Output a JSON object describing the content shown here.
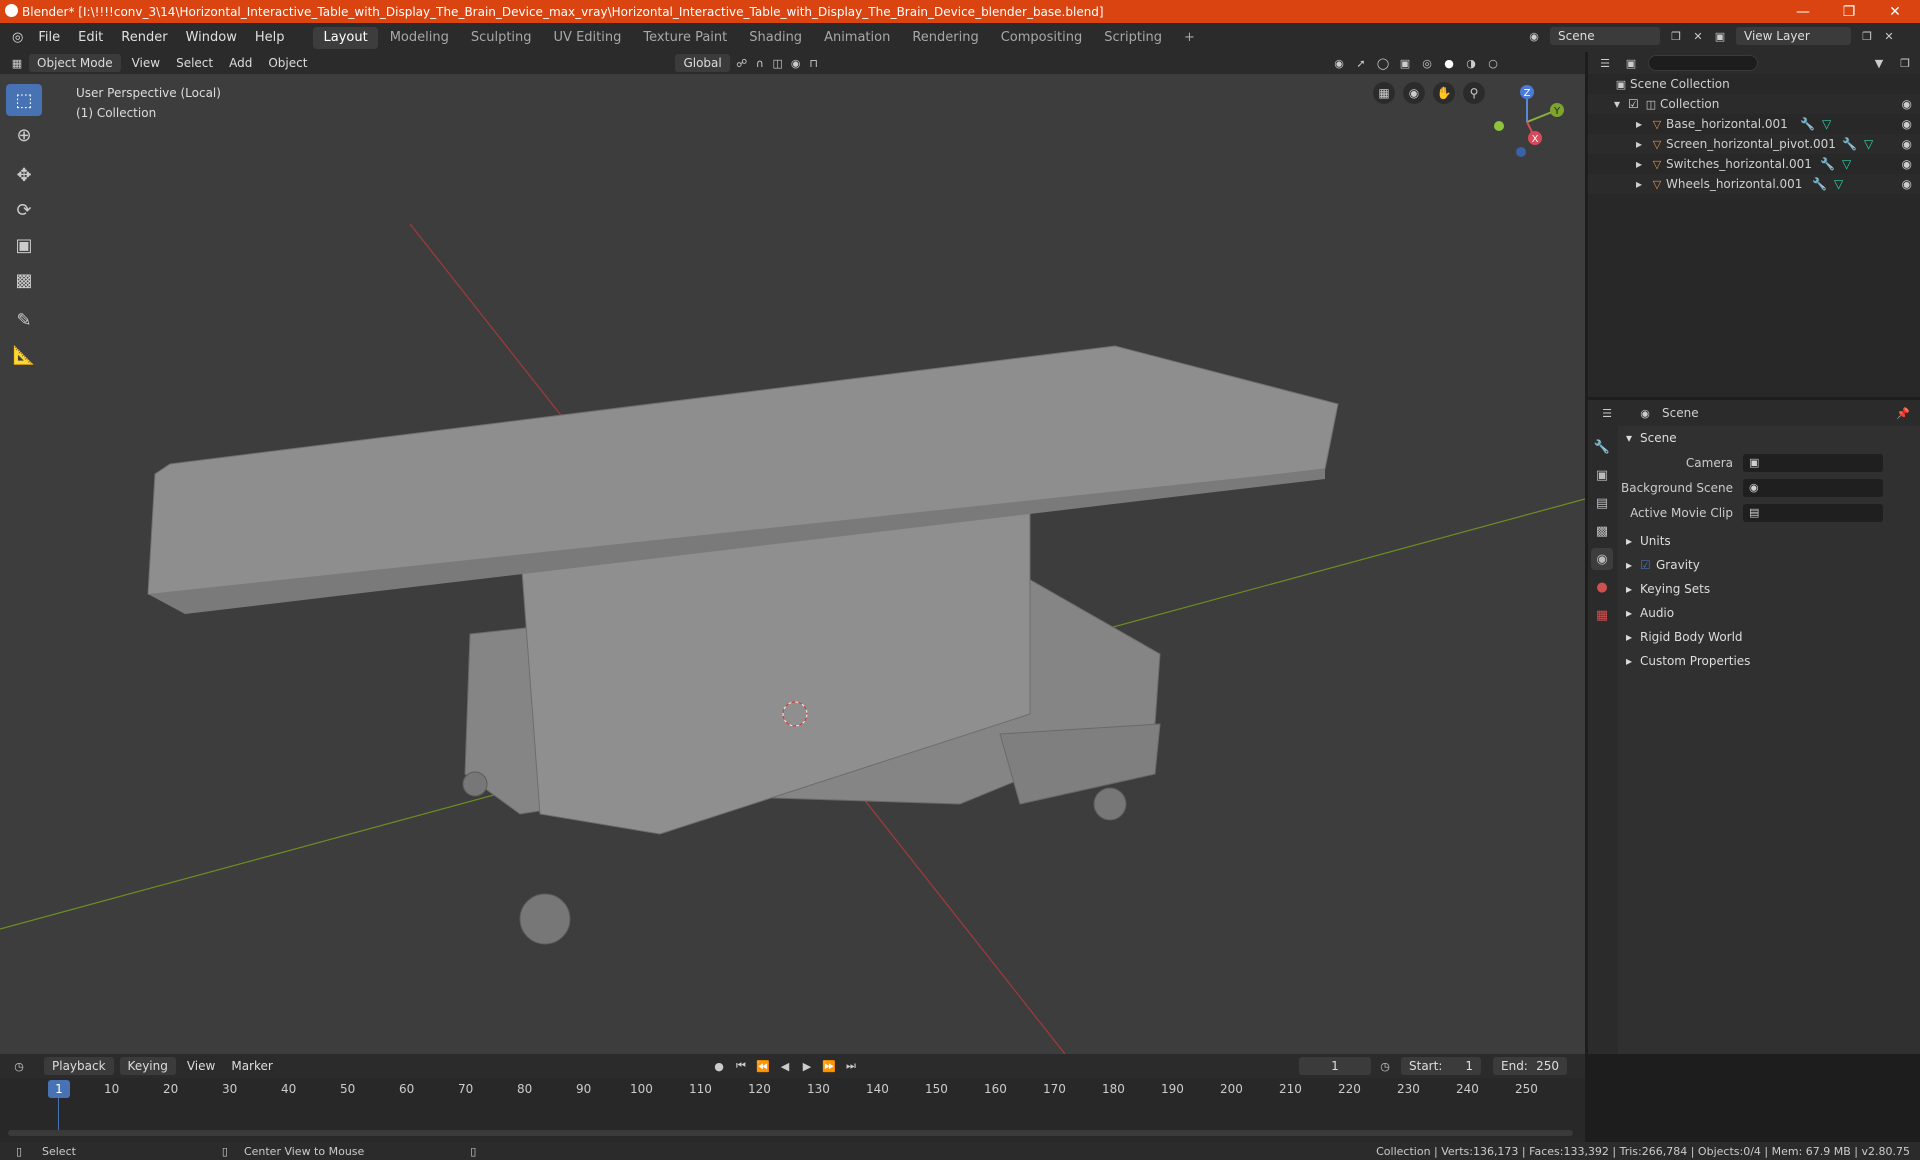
{
  "window": {
    "title": "Blender* [I:\\!!!!conv_3\\14\\Horizontal_Interactive_Table_with_Display_The_Brain_Device_max_vray\\Horizontal_Interactive_Table_with_Display_The_Brain_Device_blender_base.blend]"
  },
  "menu": {
    "file": "File",
    "edit": "Edit",
    "render": "Render",
    "window": "Window",
    "help": "Help"
  },
  "workspaces": [
    "Layout",
    "Modeling",
    "Sculpting",
    "UV Editing",
    "Texture Paint",
    "Shading",
    "Animation",
    "Rendering",
    "Compositing",
    "Scripting"
  ],
  "scene_name": "Scene",
  "view_layer": "View Layer",
  "viewport_header": {
    "mode": "Object Mode",
    "view": "View",
    "select": "Select",
    "add": "Add",
    "object": "Object",
    "orientation": "Global"
  },
  "viewport": {
    "perspective": "User Perspective (Local)",
    "collection": "(1) Collection"
  },
  "gizmo": {
    "x": "X",
    "y": "Y",
    "z": "Z"
  },
  "outliner": {
    "search_placeholder": "",
    "scene_collection": "Scene Collection",
    "collection": "Collection",
    "objects": [
      "Base_horizontal.001",
      "Screen_horizontal_pivot.001",
      "Switches_horizontal.001",
      "Wheels_horizontal.001"
    ]
  },
  "properties": {
    "context": "Scene",
    "section_scene": "Scene",
    "camera_label": "Camera",
    "background_scene_label": "Background Scene",
    "active_movie_clip_label": "Active Movie Clip",
    "sections": [
      "Units",
      "Gravity",
      "Keying Sets",
      "Audio",
      "Rigid Body World",
      "Custom Properties"
    ]
  },
  "timeline": {
    "playback": "Playback",
    "keying": "Keying",
    "view": "View",
    "marker": "Marker",
    "current_frame": "1",
    "start_label": "Start:",
    "start": "1",
    "end_label": "End:",
    "end": "250",
    "ticks": [
      "1",
      "10",
      "20",
      "30",
      "40",
      "50",
      "60",
      "70",
      "80",
      "90",
      "100",
      "110",
      "120",
      "130",
      "140",
      "150",
      "160",
      "170",
      "180",
      "190",
      "200",
      "210",
      "220",
      "230",
      "240",
      "250"
    ]
  },
  "status": {
    "select": "Select",
    "center": "Center View to Mouse",
    "info": "Collection | Verts:136,173 | Faces:133,392 | Tris:266,784 | Objects:0/4 | Mem: 67.9 MB | v2.80.75"
  }
}
